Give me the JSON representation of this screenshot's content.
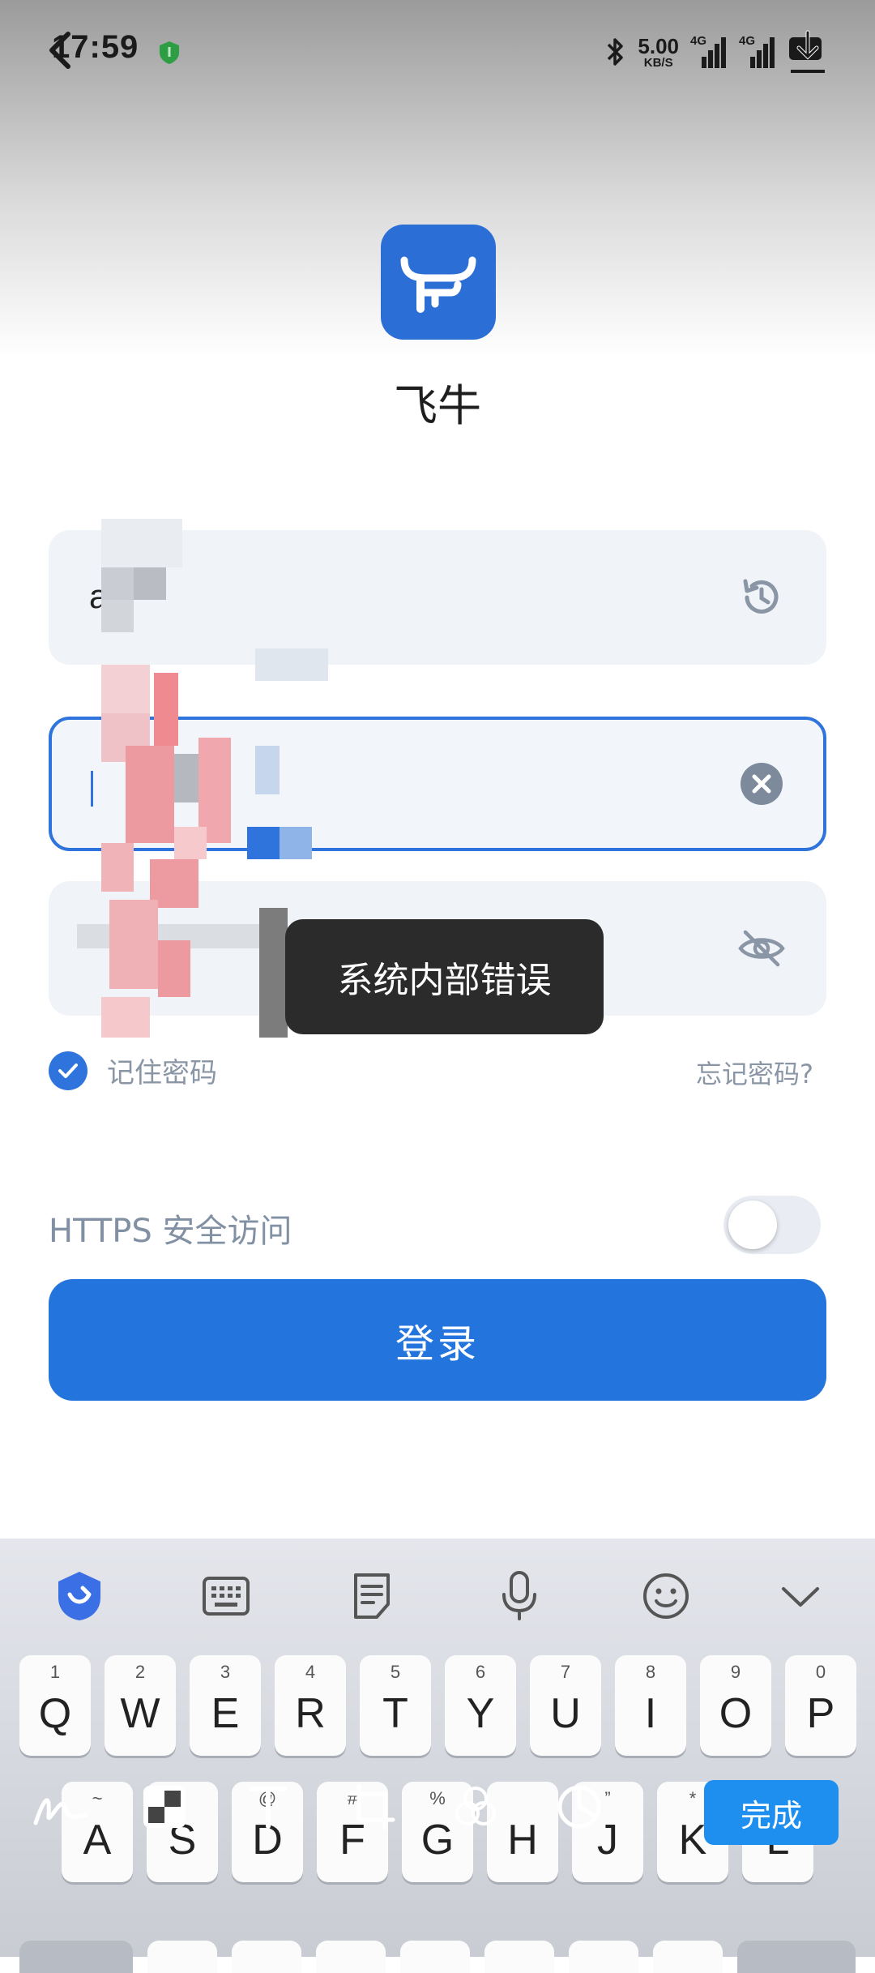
{
  "status_bar": {
    "time": "17:59",
    "net_speed_value": "5.00",
    "net_speed_unit": "KB/S",
    "sim1_tag": "4G",
    "sim2_tag": "4G"
  },
  "app": {
    "name": "飞牛",
    "logo_color": "#2b6fd6"
  },
  "form": {
    "username_value": "a s",
    "password_value": "",
    "remember_label": "记住密码",
    "forgot_label": "忘记密码?",
    "https_label": "HTTPS 安全访问",
    "https_enabled": false,
    "login_label": "登录"
  },
  "toast": {
    "message": "系统内部错误"
  },
  "keyboard": {
    "toolbar_icons": [
      "keyboard-logo-icon",
      "keyboard-layout-icon",
      "clipboard-icon",
      "microphone-icon",
      "emoji-icon",
      "collapse-chevron-icon"
    ],
    "row1": [
      {
        "ch": "Q",
        "hint": "1"
      },
      {
        "ch": "W",
        "hint": "2"
      },
      {
        "ch": "E",
        "hint": "3"
      },
      {
        "ch": "R",
        "hint": "4"
      },
      {
        "ch": "T",
        "hint": "5"
      },
      {
        "ch": "Y",
        "hint": "6"
      },
      {
        "ch": "U",
        "hint": "7"
      },
      {
        "ch": "I",
        "hint": "8"
      },
      {
        "ch": "O",
        "hint": "9"
      },
      {
        "ch": "P",
        "hint": "0"
      }
    ],
    "row2": [
      {
        "ch": "A",
        "hint": "~"
      },
      {
        "ch": "S",
        "hint": ""
      },
      {
        "ch": "D",
        "hint": "@"
      },
      {
        "ch": "F",
        "hint": "#"
      },
      {
        "ch": "G",
        "hint": "%"
      },
      {
        "ch": "H",
        "hint": ""
      },
      {
        "ch": "J",
        "hint": "”"
      },
      {
        "ch": "K",
        "hint": "*"
      },
      {
        "ch": "L",
        "hint": ""
      }
    ],
    "done_label": "完成"
  },
  "colors": {
    "accent": "#2474de",
    "toast_bg": "#2b2b2b",
    "field_bg": "#f0f3f7"
  }
}
